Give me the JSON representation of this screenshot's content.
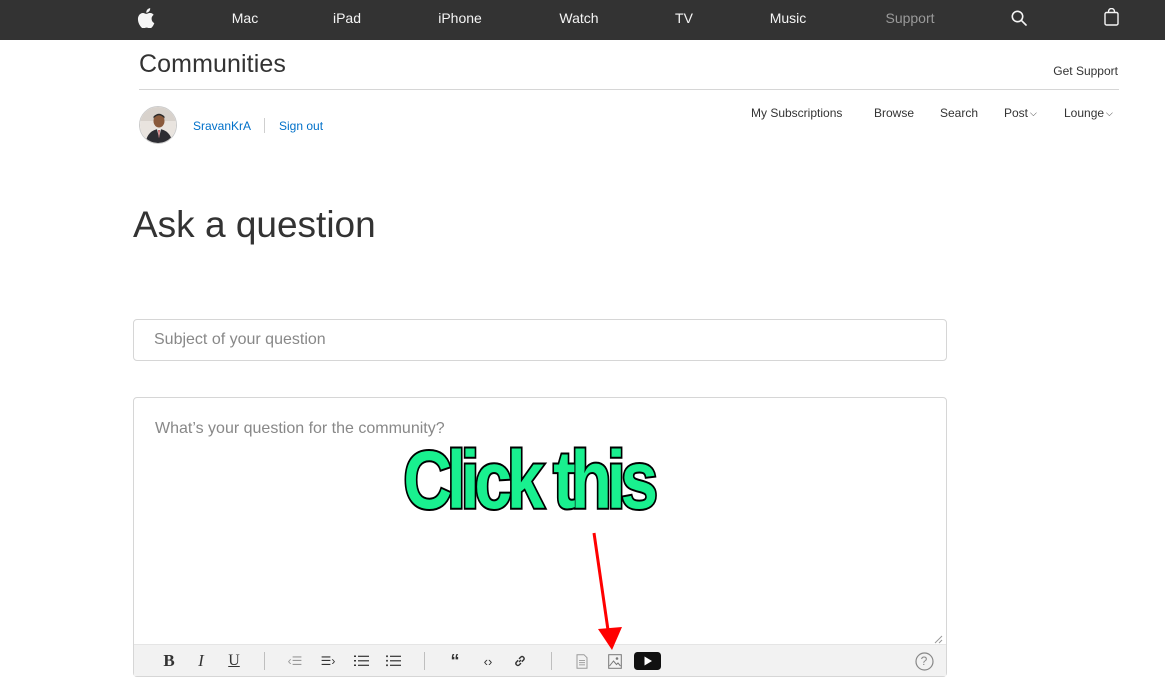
{
  "globalnav": {
    "items": [
      "Mac",
      "iPad",
      "iPhone",
      "Watch",
      "TV",
      "Music",
      "Support"
    ],
    "active": "Support"
  },
  "header": {
    "section_title": "Communities",
    "get_support": "Get Support"
  },
  "user": {
    "name": "SravanKrA",
    "sign_out": "Sign out"
  },
  "subnav": {
    "my_subscriptions": "My Subscriptions",
    "browse": "Browse",
    "search": "Search",
    "post": "Post",
    "lounge": "Lounge",
    "chevron": "⌵"
  },
  "page": {
    "title": "Ask a question"
  },
  "form": {
    "subject_placeholder": "Subject of your question",
    "body_placeholder": "What’s your question for the community?"
  },
  "toolbar": {
    "bold": "B",
    "italic": "I",
    "underline": "U",
    "outdent": "‹☰",
    "indent": "☰›",
    "quote": "“",
    "code": "‹›",
    "help": "?"
  },
  "annotation": {
    "text": "Click this",
    "fill_color": "#19f08f",
    "arrow_color": "#ff0000"
  },
  "colors": {
    "nav_bg": "#333333",
    "link": "#0070c9"
  }
}
